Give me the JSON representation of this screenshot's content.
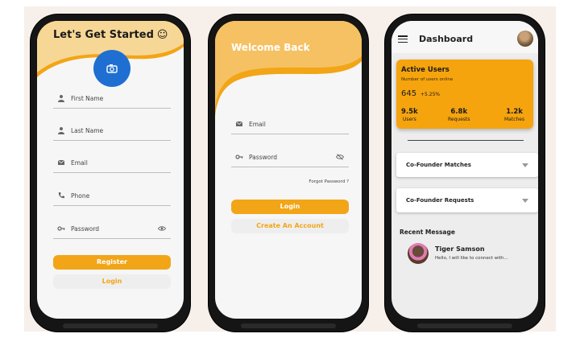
{
  "signup": {
    "title": "Let's Get Started",
    "emoji": "☺",
    "fields": [
      {
        "label": "First Name",
        "icon": "person-icon"
      },
      {
        "label": "Last Name",
        "icon": "person-icon"
      },
      {
        "label": "Email",
        "icon": "mail-icon"
      },
      {
        "label": "Phone",
        "icon": "phone-icon"
      },
      {
        "label": "Password",
        "icon": "key-icon"
      }
    ],
    "register_label": "Register",
    "login_label": "Login"
  },
  "login": {
    "title": "Welcome Back",
    "fields": [
      {
        "label": "Email",
        "icon": "mail-icon"
      },
      {
        "label": "Password",
        "icon": "key-icon"
      }
    ],
    "forgot_label": "Forgot Password ?",
    "login_label": "Login",
    "create_label": "Create An Account"
  },
  "dashboard": {
    "title": "Dashboard",
    "active_users": {
      "title": "Active Users",
      "subtitle": "Number of users online",
      "count": "645",
      "change": "+5.25%",
      "stats": [
        {
          "value": "9.5k",
          "label": "Users"
        },
        {
          "value": "6.8k",
          "label": "Requests"
        },
        {
          "value": "1.2k",
          "label": "Matches"
        }
      ]
    },
    "sections": [
      "Co-Founder Matches",
      "Co-Founder Requests"
    ],
    "recent_title": "Recent Message",
    "message": {
      "name": "Tiger Samson",
      "text": "Hello, I will like to connect with..."
    }
  },
  "colors": {
    "accent": "#f2a516",
    "primary_blue": "#1e6fd1"
  }
}
